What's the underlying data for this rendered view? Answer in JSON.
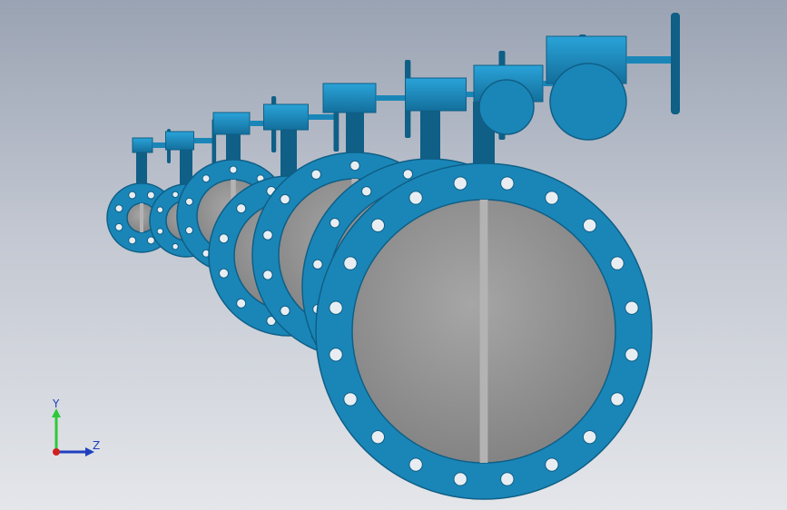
{
  "viewport": {
    "background_top": "#9aa3b3",
    "background_bottom": "#e4e6ea"
  },
  "model": {
    "part_color": "#1a86b8",
    "part_dark": "#0f5f86",
    "disc_color": "#8c8c8c",
    "stem_color": "#b3b3b3"
  },
  "triad": {
    "y_label": "Y",
    "z_label": "Z",
    "y_color": "#2ec93a",
    "z_color": "#1f3fbf",
    "x_color": "#d12020"
  }
}
